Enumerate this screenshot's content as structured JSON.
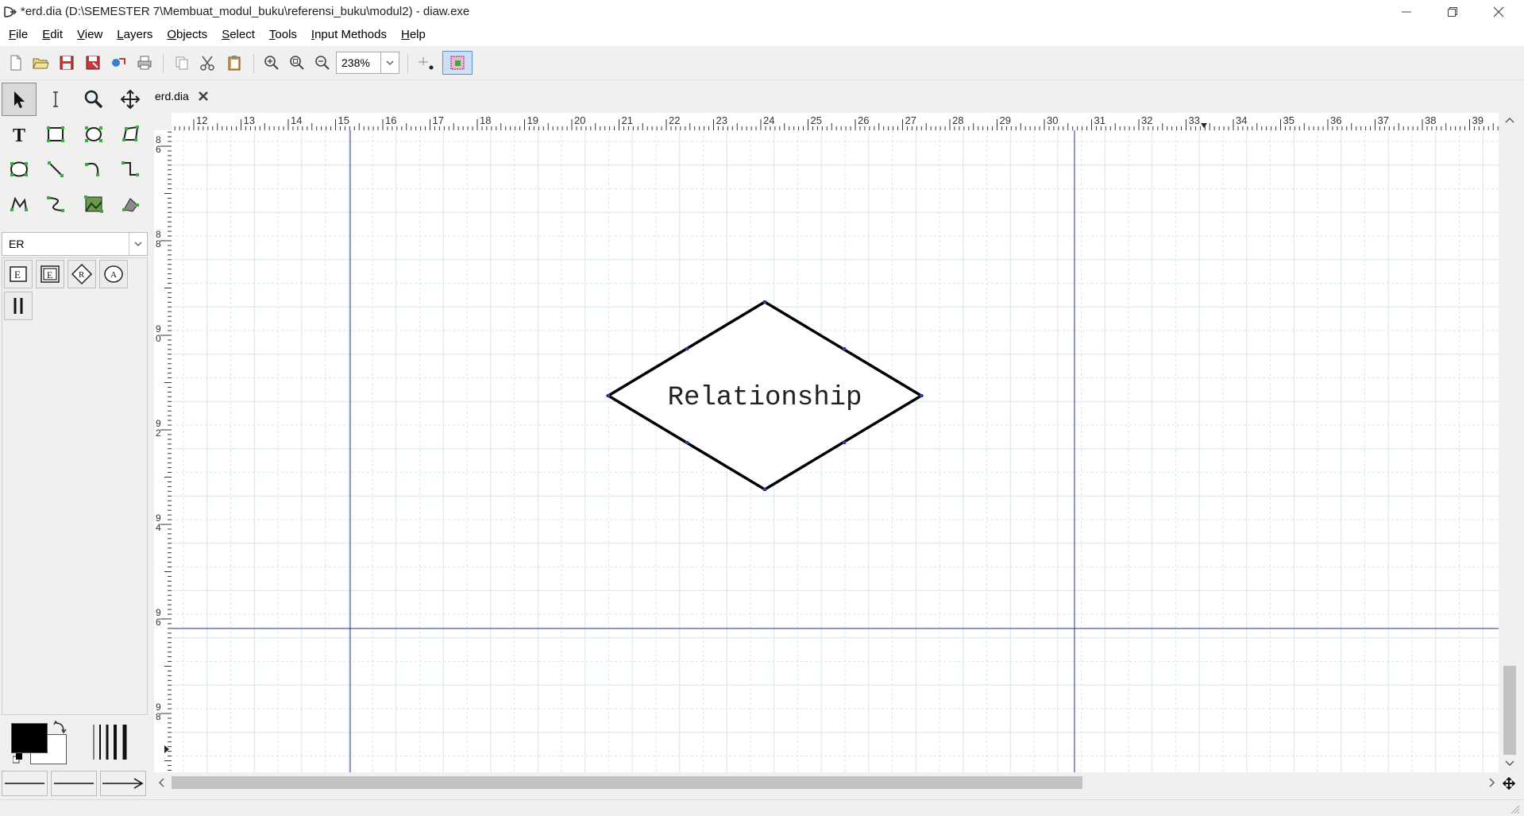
{
  "window": {
    "title": "*erd.dia (D:\\SEMESTER 7\\Membuat_modul_buku\\referensi_buku\\modul2) - diaw.exe",
    "minimize_icon": "minimize-icon",
    "restore_icon": "restore-icon",
    "close_icon": "close-icon"
  },
  "menu": [
    {
      "label": "File"
    },
    {
      "label": "Edit"
    },
    {
      "label": "View"
    },
    {
      "label": "Layers"
    },
    {
      "label": "Objects"
    },
    {
      "label": "Select"
    },
    {
      "label": "Tools"
    },
    {
      "label": "Input Methods"
    },
    {
      "label": "Help"
    }
  ],
  "toolbar": {
    "zoom_value": "238%"
  },
  "toolbox": {
    "sheet_selected": "ER"
  },
  "tabs": [
    {
      "label": "erd.dia"
    }
  ],
  "rulers": {
    "horizontal": [
      "12",
      "13",
      "14",
      "15",
      "16",
      "17",
      "18",
      "19",
      "20",
      "21",
      "22",
      "23",
      "24",
      "25",
      "26",
      "27",
      "28",
      "29",
      "30",
      "31",
      "32",
      "33",
      "34",
      "35",
      "36",
      "37",
      "38",
      "39"
    ],
    "vertical": [
      "8 6",
      "8 8",
      "9 0",
      "9 2",
      "9 4",
      "9 6",
      "9 8"
    ]
  },
  "diagram": {
    "relationship_label": "Relationship"
  },
  "colors": {
    "guide_line": "#1f2f8f",
    "grid_line": "#d8e6ea",
    "diamond_stroke": "#000000",
    "accent_selected": "#3a6fd8"
  }
}
